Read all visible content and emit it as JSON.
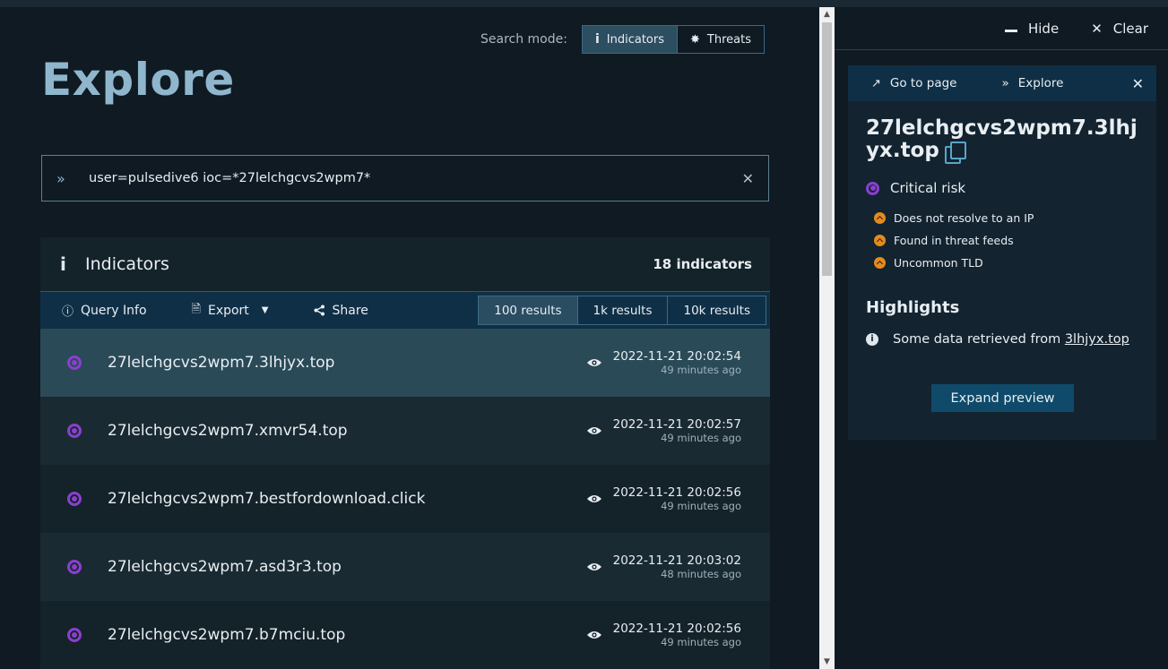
{
  "search_mode": {
    "label": "Search mode:",
    "options": [
      {
        "label": "Indicators",
        "icon": "info-icon",
        "active": true
      },
      {
        "label": "Threats",
        "icon": "bug-icon",
        "active": false
      }
    ]
  },
  "page_title": "Explore",
  "query": {
    "value": "user=pulsedive6 ioc=*27lelchgcvs2wpm7*"
  },
  "panel": {
    "title": "Indicators",
    "count": "18 indicators",
    "toolbar": {
      "query_info": "Query Info",
      "export": "Export",
      "share": "Share"
    },
    "result_sizes": [
      {
        "label": "100 results",
        "active": true
      },
      {
        "label": "1k results",
        "active": false
      },
      {
        "label": "10k results",
        "active": false
      }
    ],
    "rows": [
      {
        "name": "27lelchgcvs2wpm7.3lhjyx.top",
        "time": "2022-11-21 20:02:54",
        "ago": "49 minutes ago"
      },
      {
        "name": "27lelchgcvs2wpm7.xmvr54.top",
        "time": "2022-11-21 20:02:57",
        "ago": "49 minutes ago"
      },
      {
        "name": "27lelchgcvs2wpm7.bestfordownload.click",
        "time": "2022-11-21 20:02:56",
        "ago": "49 minutes ago"
      },
      {
        "name": "27lelchgcvs2wpm7.asd3r3.top",
        "time": "2022-11-21 20:03:02",
        "ago": "48 minutes ago"
      },
      {
        "name": "27lelchgcvs2wpm7.b7mciu.top",
        "time": "2022-11-21 20:02:56",
        "ago": "49 minutes ago"
      }
    ]
  },
  "side": {
    "hide": "Hide",
    "clear": "Clear",
    "preview": {
      "go_to_page": "Go to page",
      "explore": "Explore",
      "domain": "27lelchgcvs2wpm7.3lhjyx.top",
      "risk": "Critical risk",
      "reasons": [
        "Does not resolve to an IP",
        "Found in threat feeds",
        "Uncommon TLD"
      ],
      "highlights_title": "Highlights",
      "highlight_text": "Some data retrieved from",
      "highlight_link": "3lhjyx.top",
      "expand": "Expand preview"
    }
  },
  "colors": {
    "background": "#0f1a22",
    "accent": "#8fb6cc",
    "critical": "#8a3fcf",
    "warning": "#e68a1a",
    "toolbar": "#0f2f46"
  }
}
